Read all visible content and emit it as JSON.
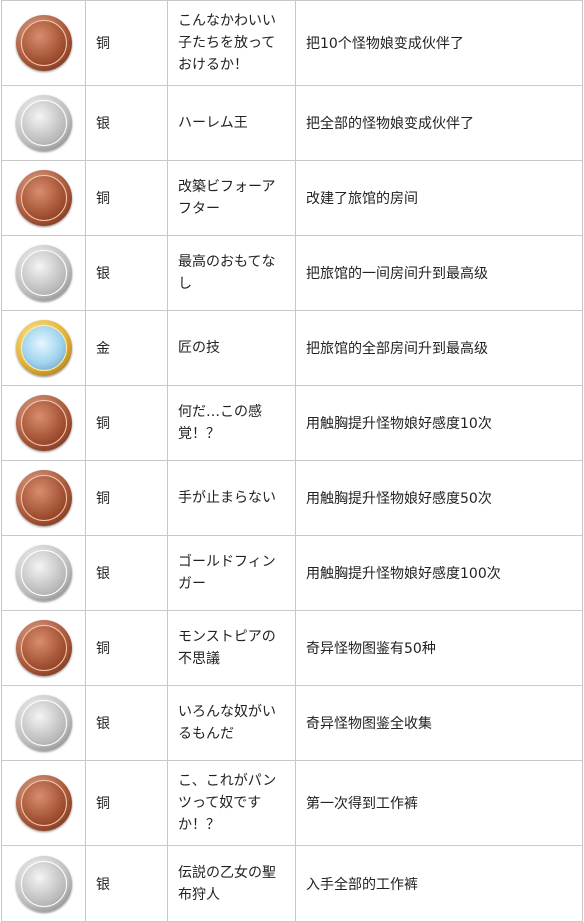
{
  "colors": {
    "bronze": "#a65335",
    "silver": "#bdbdbd",
    "gold": "#e4b23a"
  },
  "rows": [
    {
      "medal": "bronze",
      "icon": "bronze-medal-icon",
      "tier": "铜",
      "name": "こんなかわいい子たちを放っておけるか！",
      "desc": "把10个怪物娘变成伙伴了"
    },
    {
      "medal": "silver",
      "icon": "silver-medal-icon",
      "tier": "银",
      "name": "ハーレム王",
      "desc": "把全部的怪物娘变成伙伴了"
    },
    {
      "medal": "bronze",
      "icon": "bronze-medal-icon",
      "tier": "铜",
      "name": "改築ビフォーアフター",
      "desc": "改建了旅馆的房间"
    },
    {
      "medal": "silver",
      "icon": "silver-medal-icon",
      "tier": "银",
      "name": "最高のおもてなし",
      "desc": "把旅馆的一间房间升到最高级"
    },
    {
      "medal": "gold",
      "icon": "gold-medal-icon",
      "tier": "金",
      "name": "匠の技",
      "desc": "把旅馆的全部房间升到最高级"
    },
    {
      "medal": "bronze",
      "icon": "bronze-medal-icon",
      "tier": "铜",
      "name": "何だ…この感覚！？",
      "desc": "用触胸提升怪物娘好感度10次"
    },
    {
      "medal": "bronze",
      "icon": "bronze-medal-icon",
      "tier": "铜",
      "name": "手が止まらない",
      "desc": "用触胸提升怪物娘好感度50次"
    },
    {
      "medal": "silver",
      "icon": "silver-medal-icon",
      "tier": "银",
      "name": "ゴールドフィンガー",
      "desc": "用触胸提升怪物娘好感度100次"
    },
    {
      "medal": "bronze",
      "icon": "bronze-medal-icon",
      "tier": "铜",
      "name": "モンストピアの不思議",
      "desc": "奇异怪物图鉴有50种"
    },
    {
      "medal": "silver",
      "icon": "silver-medal-icon",
      "tier": "银",
      "name": "いろんな奴がいるもんだ",
      "desc": "奇异怪物图鉴全收集"
    },
    {
      "medal": "bronze",
      "icon": "bronze-medal-icon",
      "tier": "铜",
      "name": "こ、これがパンツって奴ですか！？",
      "desc": "第一次得到工作裤"
    },
    {
      "medal": "silver",
      "icon": "silver-medal-icon",
      "tier": "银",
      "name": "伝説の乙女の聖布狩人",
      "desc": "入手全部的工作裤"
    }
  ]
}
